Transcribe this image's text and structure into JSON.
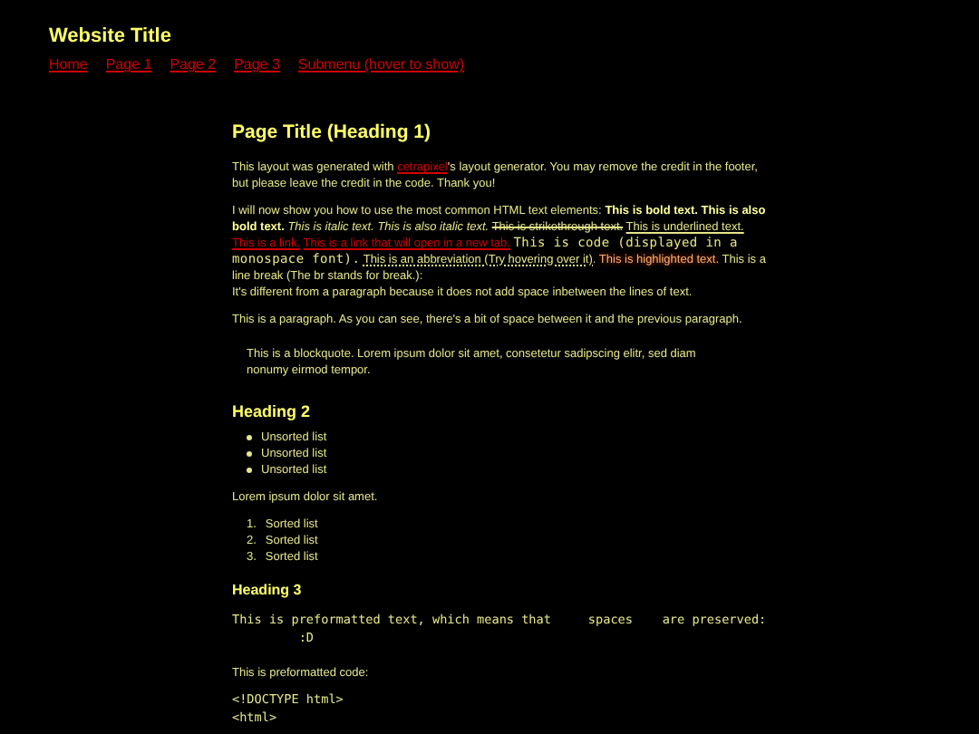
{
  "header": {
    "title": "Website Title",
    "nav": [
      {
        "label": "Home"
      },
      {
        "label": "Page 1"
      },
      {
        "label": "Page 2"
      },
      {
        "label": "Page 3"
      },
      {
        "label": "Submenu (hover to show)"
      }
    ]
  },
  "content": [
    {
      "kind": "h1",
      "text": "Page Title (Heading 1)"
    },
    {
      "kind": "p",
      "segments": [
        {
          "kind": "text",
          "text": "This layout was generated with "
        },
        {
          "kind": "link",
          "text": "cetrapixel"
        },
        {
          "kind": "text",
          "text": "'s layout generator. You may remove the credit in the footer, but please leave the credit in the code. Thank you!"
        }
      ]
    },
    {
      "kind": "p",
      "segments": [
        {
          "kind": "text",
          "text": "I will now show you how to use the most common HTML text elements: "
        },
        {
          "kind": "bold",
          "text": "This is bold text."
        },
        {
          "kind": "bold",
          "text": "This is also bold text."
        },
        {
          "kind": "italic",
          "text": "This is italic text."
        },
        {
          "kind": "italic",
          "text": "This is also italic text."
        },
        {
          "kind": "strike",
          "text": "This is strikethrough text."
        },
        {
          "kind": "underline",
          "text": "This is underlined text."
        },
        {
          "kind": "link",
          "text": "This is a link."
        },
        {
          "kind": "link",
          "text": "This is a link that will open in a new tab."
        },
        {
          "kind": "code",
          "text": "This is code (displayed in a monospace font)."
        },
        {
          "kind": "abbr",
          "text": "This is an abbreviation (Try hovering over it)."
        },
        {
          "kind": "highlight",
          "text": "This is highlighted text."
        },
        {
          "kind": "text",
          "text": " This is a line break (The br stands for break.):"
        },
        {
          "kind": "br"
        },
        {
          "kind": "text",
          "text": "It's different from a paragraph because it does not add space inbetween the lines of text."
        }
      ]
    },
    {
      "kind": "p",
      "segments": [
        {
          "kind": "text",
          "text": "This is a paragraph. As you can see, there's a bit of space between it and the previous paragraph."
        }
      ]
    },
    {
      "kind": "blockquote",
      "text": "This is a blockquote. Lorem ipsum dolor sit amet, consetetur sadipscing elitr, sed diam nonumy eirmod tempor."
    },
    {
      "kind": "h2",
      "text": "Heading 2"
    },
    {
      "kind": "ul",
      "items": [
        {
          "text": "Unsorted list"
        },
        {
          "text": "Unsorted list"
        },
        {
          "text": "Unsorted list"
        }
      ]
    },
    {
      "kind": "p",
      "segments": [
        {
          "kind": "text",
          "text": "Lorem ipsum dolor sit amet."
        }
      ]
    },
    {
      "kind": "ol",
      "items": [
        {
          "number": "1.",
          "text": "Sorted list"
        },
        {
          "number": "2.",
          "text": "Sorted list"
        },
        {
          "number": "3.",
          "text": "Sorted list"
        }
      ]
    },
    {
      "kind": "h3",
      "text": "Heading 3"
    },
    {
      "kind": "pre",
      "lines": [
        "This is preformatted text, which means that     spaces    are preserved:",
        "         :D"
      ]
    },
    {
      "kind": "p",
      "segments": [
        {
          "kind": "text",
          "text": "This is preformatted code:"
        }
      ]
    },
    {
      "kind": "pre",
      "lines": [
        "<!DOCTYPE html>",
        "<html>"
      ]
    }
  ]
}
